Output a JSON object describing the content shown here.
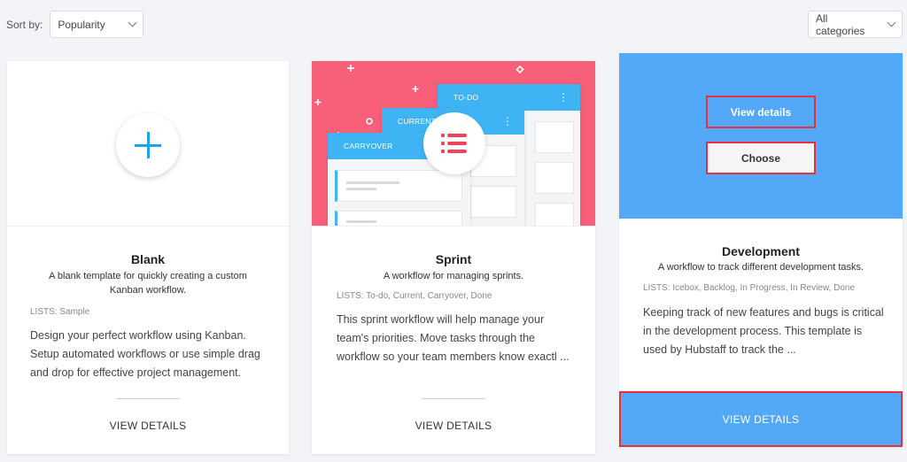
{
  "toolbar": {
    "sort_label": "Sort by:",
    "sort_value": "Popularity",
    "category_value": "All categories"
  },
  "cards": [
    {
      "title": "Blank",
      "description": "A blank template for quickly creating a custom Kanban workflow.",
      "lists": "LISTS: Sample",
      "body": "Design your perfect workflow using Kanban. Setup automated workflows or use simple drag and drop for effective project management.",
      "link": "VIEW DETAILS",
      "icon": "plus-icon"
    },
    {
      "title": "Sprint",
      "description": "A workflow for managing sprints.",
      "lists": "LISTS: To-do, Current, Carryover, Done",
      "body": "This sprint workflow will help manage your team's priorities. Move tasks through the workflow so your team members know exactl ...",
      "link": "VIEW DETAILS",
      "illustration": {
        "columns": [
          "TO-DO",
          "CURRENT",
          "CARRYOVER"
        ],
        "icon": "list-icon"
      }
    },
    {
      "title": "Development",
      "description": "A workflow to track different development tasks.",
      "lists": "LISTS: Icebox, Backlog, In Progress, In Review, Done",
      "body": "Keeping track of new features and bugs is critical in the development process. This template is used by Hubstaff to track the ...",
      "view_details_button": "View details",
      "choose_button": "Choose",
      "link": "VIEW DETAILS"
    }
  ],
  "colors": {
    "accent": "#53a8f8",
    "sprint_bg": "#f8607a",
    "highlight_border": "#e8303c",
    "list_header": "#3fb4f5"
  }
}
